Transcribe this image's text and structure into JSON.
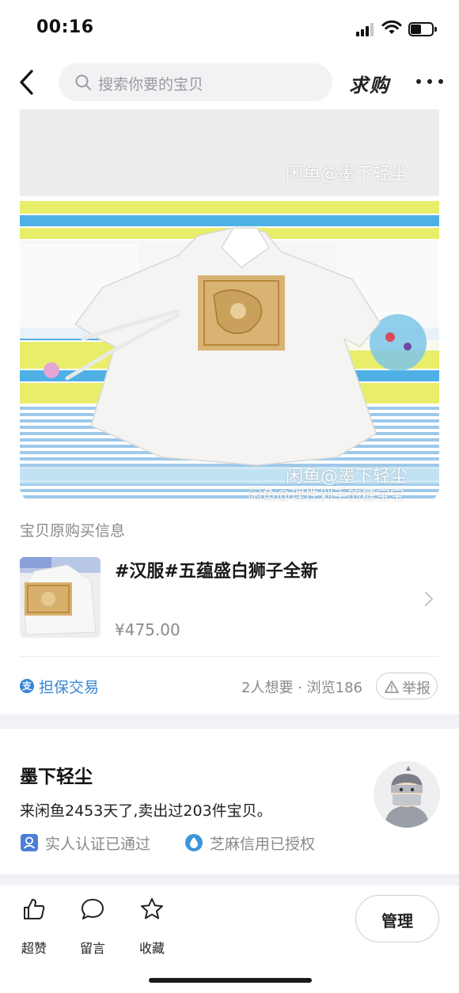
{
  "status_bar": {
    "time": "00:16"
  },
  "nav": {
    "search_placeholder": "搜索你要的宝贝",
    "qiugou_label": "求购"
  },
  "product_image": {
    "watermark_top": "闲鱼@墨下轻尘",
    "watermark_bottom": "闲鱼@墨下轻尘",
    "watermark_bottom_sub": "闲鱼@理性剁手的糖宝宝"
  },
  "purchase_info": {
    "section_label": "宝贝原购买信息",
    "title": "#汉服#五蕴盛白狮子全新",
    "price": "¥475.00"
  },
  "trade": {
    "badge_glyph": "支",
    "label": "担保交易",
    "stats": "2人想要 · 浏览186",
    "report_label": "举报"
  },
  "seller": {
    "name": "墨下轻尘",
    "description": "来闲鱼2453天了,卖出过203件宝贝。",
    "cert_realname": "实人认证已通过",
    "cert_zhima": "芝麻信用已授权"
  },
  "bottom_bar": {
    "like_label": "超赞",
    "comment_label": "留言",
    "favorite_label": "收藏",
    "manage_label": "管理"
  },
  "colors": {
    "accent_blue": "#3a86d8",
    "text_secondary": "#8a8a8f",
    "section_gap": "#f1f2f6"
  },
  "icons": [
    "back-arrow-icon",
    "search-icon",
    "more-dots-icon",
    "chevron-right-icon",
    "alipay-icon",
    "warning-triangle-icon",
    "person-badge-icon",
    "water-drop-icon",
    "thumbs-up-icon",
    "chat-bubble-icon",
    "star-icon"
  ]
}
